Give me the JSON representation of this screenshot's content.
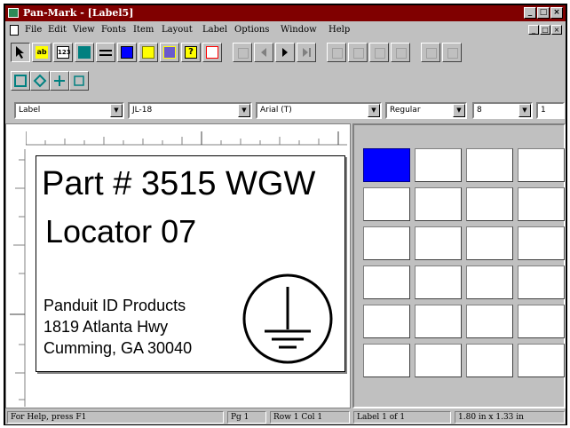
{
  "window": {
    "title": "Pan-Mark - [Label5]",
    "controls": [
      "_",
      "□",
      "×"
    ]
  },
  "menu": {
    "items": [
      "File",
      "Edit",
      "View",
      "Fonts",
      "Item",
      "Layout",
      "Label",
      "Options",
      "Window",
      "Help"
    ],
    "mdi_controls": [
      "_",
      "□",
      "×"
    ]
  },
  "toolbar": {
    "text_tool": "ab",
    "number_tool": "123",
    "help_tool": "?"
  },
  "format_bar": {
    "object_type": "Label",
    "label_part": "JL-18",
    "font": "Arial (T)",
    "style": "Regular",
    "size": "8",
    "count": "1"
  },
  "label": {
    "line1": "Part # 3515 WGW",
    "line2": "Locator 07",
    "address": [
      "Panduit ID Products",
      "1819 Atlanta Hwy",
      "Cumming, GA  30040"
    ]
  },
  "label_grid": {
    "rows": 6,
    "cols": 4,
    "active_index": 0,
    "active_color": "#0000ff"
  },
  "status": {
    "help": "For Help, press F1",
    "page": "Pg 1",
    "position": "Row 1 Col 1",
    "label_count": "Label 1 of 1",
    "size": "1.80 in x 1.33 in"
  },
  "colors": {
    "title_bar": "#800000",
    "face": "#c0c0c0"
  }
}
